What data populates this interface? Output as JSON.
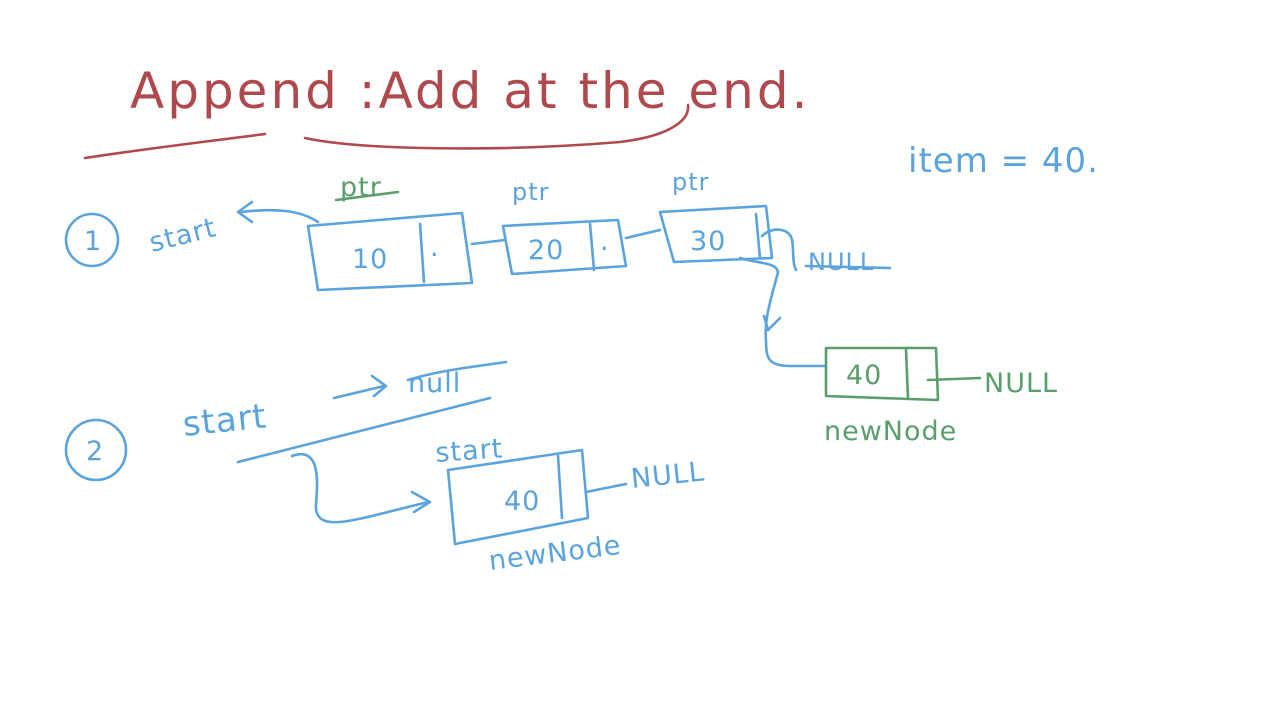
{
  "colors": {
    "background": "#ffffff",
    "title_red": "#b0494e",
    "ink_blue": "#5aa3dc",
    "ink_green": "#5a9e6c"
  },
  "title": "Append :Add at the end.",
  "item_note": "item = 40.",
  "case1": {
    "step_label": "1",
    "start_label": "start",
    "pointer_labels": [
      "ptr",
      "ptr",
      "ptr"
    ],
    "nodes": [
      {
        "value": "10",
        "next": "."
      },
      {
        "value": "20",
        "next": "."
      },
      {
        "value": "30",
        "next": ""
      }
    ],
    "crossed_null": "NULL",
    "new_node": {
      "value": "40",
      "null_label": "NULL",
      "caption": "newNode"
    }
  },
  "case2": {
    "step_label": "2",
    "start_label": "start",
    "arrow": "->",
    "crossed_null": "null",
    "node_label": "start",
    "new_node": {
      "value": "40",
      "null_label": "NULL",
      "caption": "newNode"
    }
  }
}
